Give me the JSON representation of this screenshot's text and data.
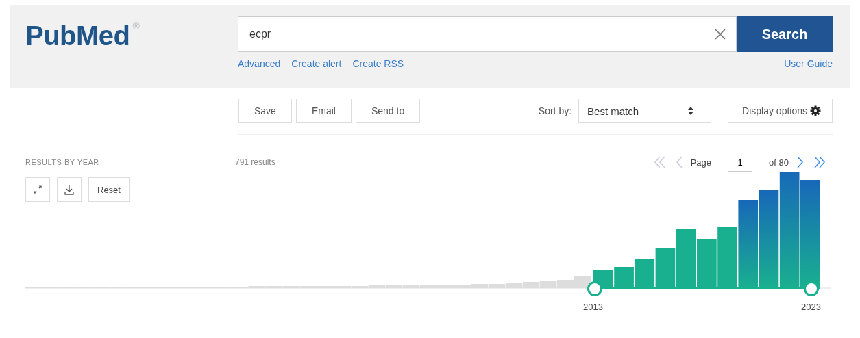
{
  "header": {
    "logo": "PubMed",
    "logo_mark": "®",
    "search": {
      "value": "ecpr"
    },
    "search_button": "Search",
    "links": [
      "Advanced",
      "Create alert",
      "Create RSS"
    ],
    "user_guide": "User Guide"
  },
  "toolbar": {
    "buttons": [
      "Save",
      "Email",
      "Send to"
    ],
    "sort_label": "Sort by:",
    "sort_value": "Best match",
    "display_options": "Display options"
  },
  "timeline": {
    "title": "RESULTS BY YEAR",
    "reset": "Reset",
    "range_start": "2013",
    "range_end": "2023"
  },
  "results": {
    "count": "791 results",
    "page_label": "Page",
    "page_value": "1",
    "page_total": "of 80"
  }
}
